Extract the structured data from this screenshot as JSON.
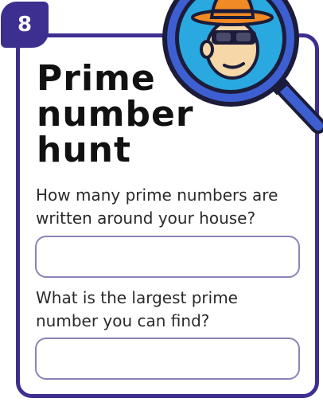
{
  "badge": {
    "number": "8"
  },
  "title": {
    "line1": "Prime",
    "line2": "number",
    "line3": "hunt"
  },
  "questions": [
    {
      "text": "How many prime numbers are written around your house?",
      "answer_value": ""
    },
    {
      "text": "What is the largest prime number you can find?",
      "answer_value": ""
    }
  ],
  "colors": {
    "frame": "#3d2f8f",
    "lens": "#2aa8e0",
    "hat": "#f08a24",
    "field_border": "#8a84b6"
  },
  "icons": {
    "illustration": "detective-magnifying-glass-icon"
  }
}
